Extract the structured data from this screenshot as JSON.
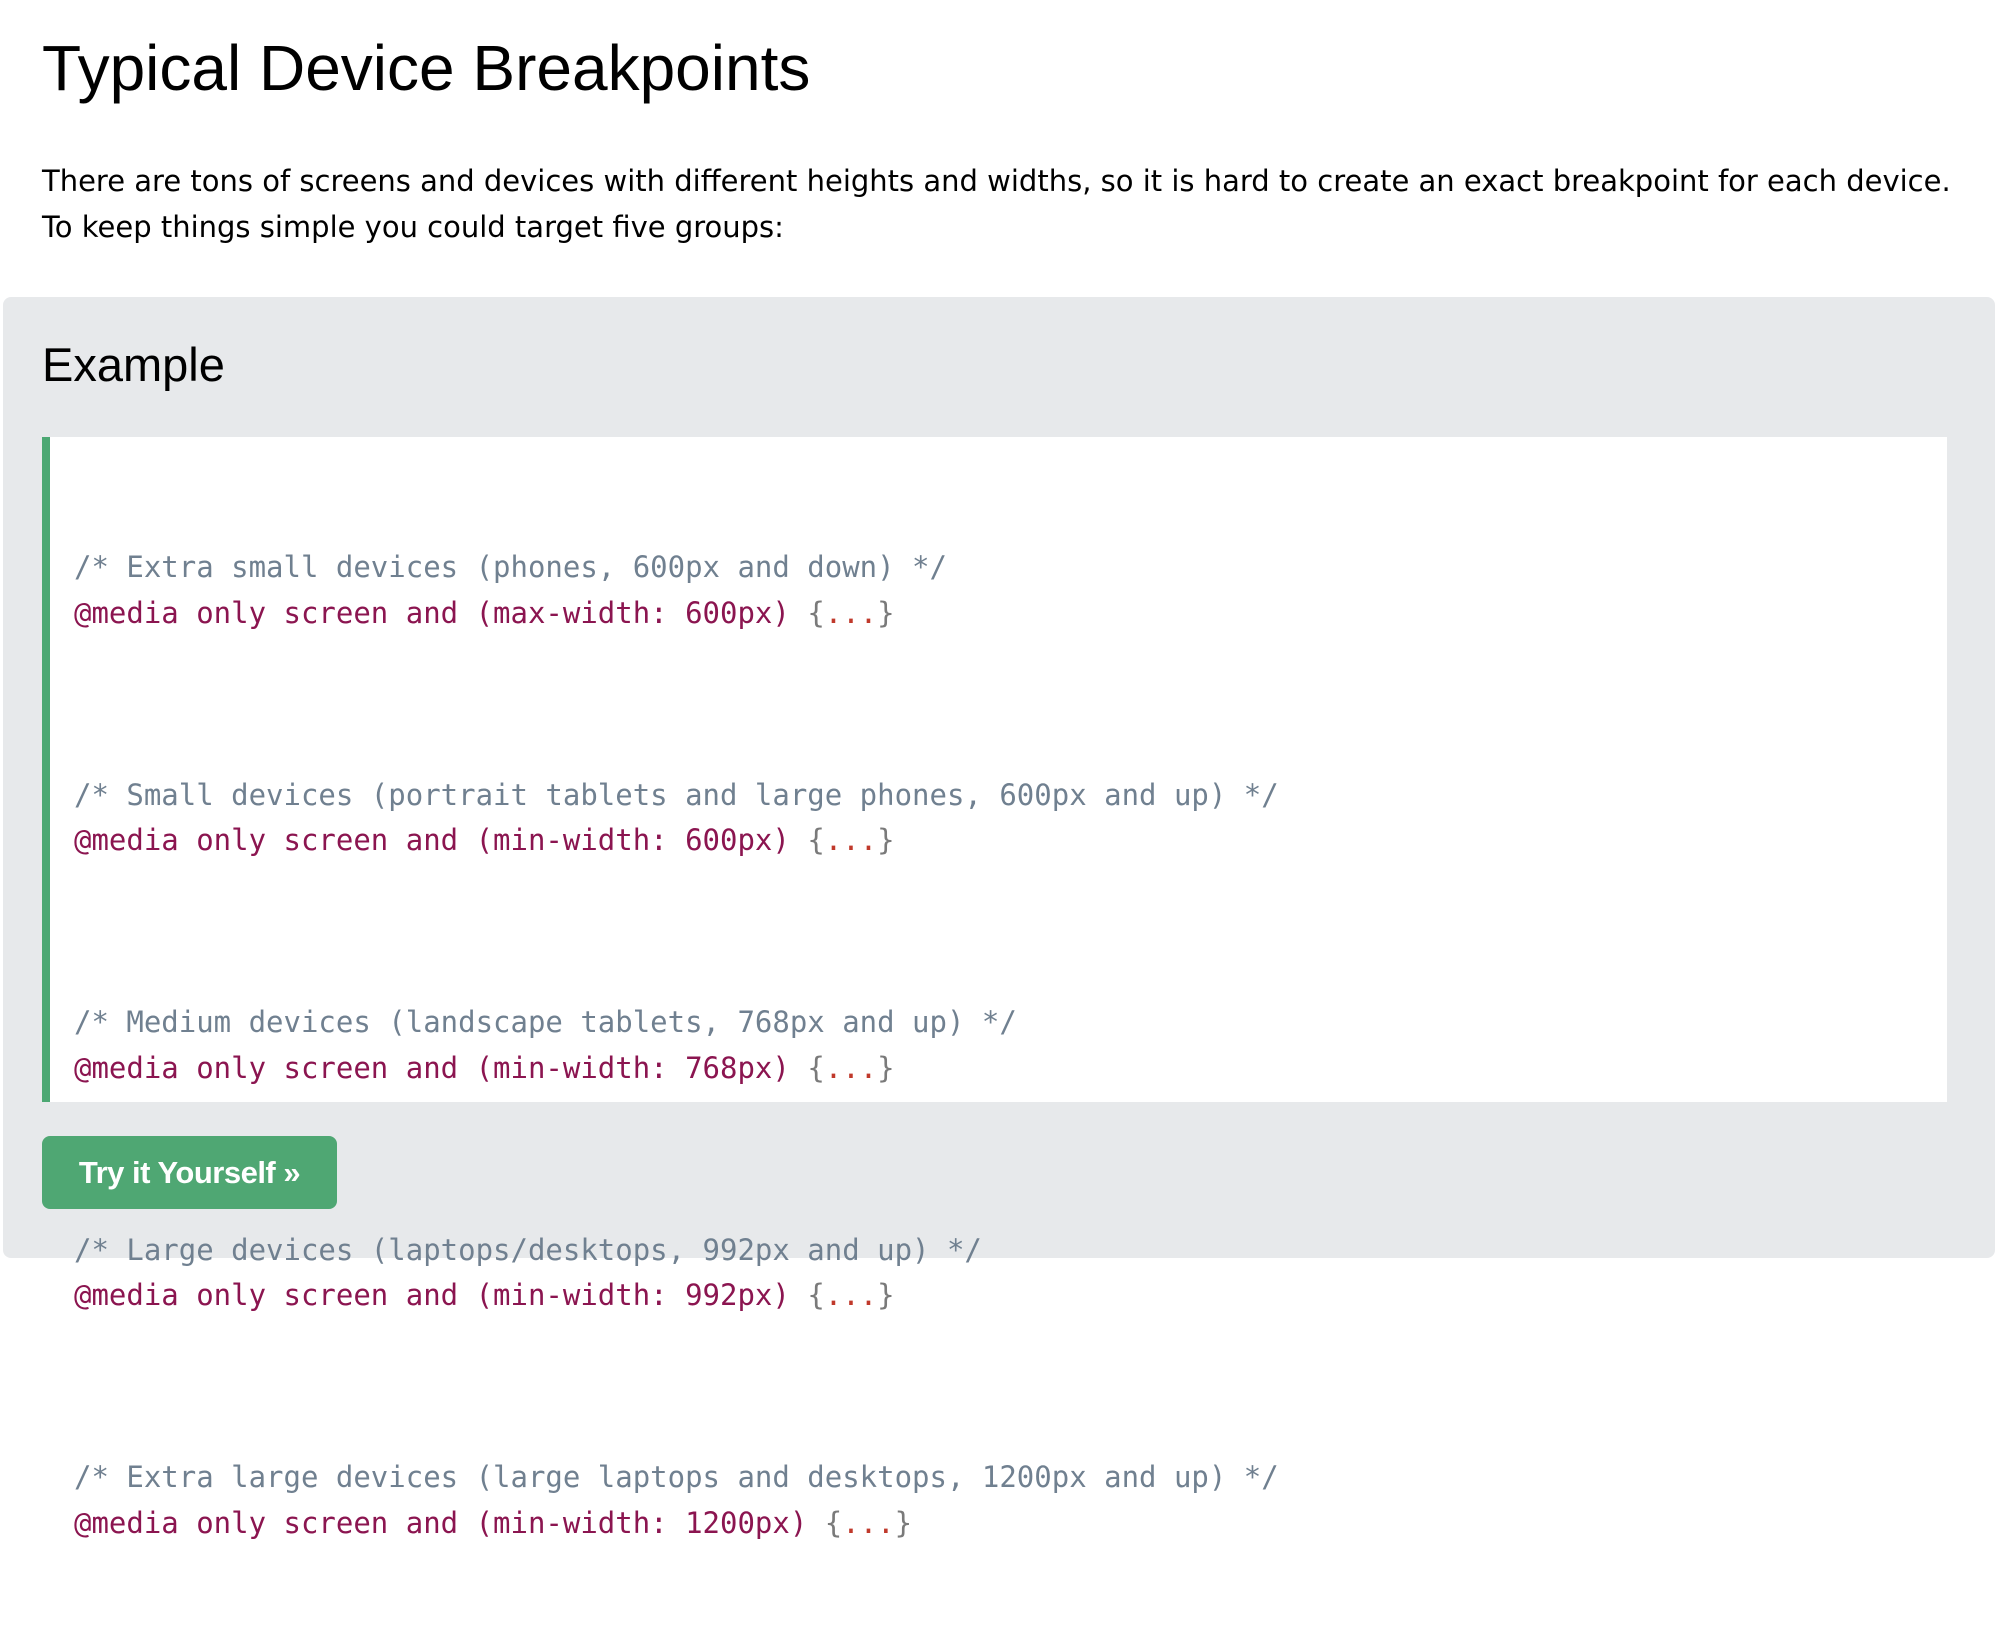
{
  "page": {
    "title": "Typical Device Breakpoints",
    "intro": "There are tons of screens and devices with different heights and widths, so it is hard to create an exact breakpoint for each device. To keep things simple you could target five groups:"
  },
  "example": {
    "title": "Example",
    "code": [
      {
        "comment": "/* Extra small devices (phones, 600px and down) */",
        "rule": "@media only screen and (max-width: 600px) ",
        "open": "{",
        "dots": "...",
        "close": "}"
      },
      {
        "comment": "/* Small devices (portrait tablets and large phones, 600px and up) */",
        "rule": "@media only screen and (min-width: 600px) ",
        "open": "{",
        "dots": "...",
        "close": "}"
      },
      {
        "comment": "/* Medium devices (landscape tablets, 768px and up) */",
        "rule": "@media only screen and (min-width: 768px) ",
        "open": "{",
        "dots": "...",
        "close": "}"
      },
      {
        "comment": "/* Large devices (laptops/desktops, 992px and up) */",
        "rule": "@media only screen and (min-width: 992px) ",
        "open": "{",
        "dots": "...",
        "close": "}"
      },
      {
        "comment": "/* Extra large devices (large laptops and desktops, 1200px and up) */",
        "rule": "@media only screen and (min-width: 1200px) ",
        "open": "{",
        "dots": "...",
        "close": "}"
      }
    ],
    "button_label": "Try it Yourself »"
  },
  "colors": {
    "accent": "#4FA773",
    "example_bg": "#E7E9EB",
    "comment": "#708090",
    "rule": "#8B1550"
  }
}
